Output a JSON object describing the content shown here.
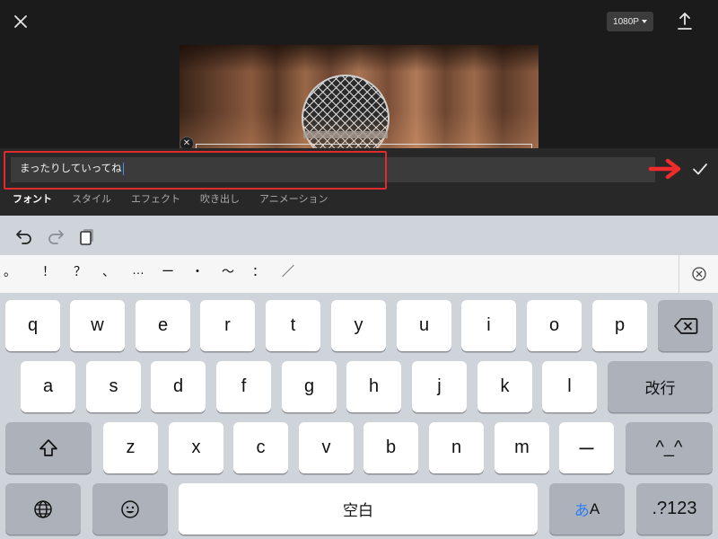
{
  "editor": {
    "resolution_label": "1080P",
    "icons": {
      "close": "close-icon",
      "export": "export-icon",
      "confirm": "checkmark-icon",
      "arrow": "red-arrow-icon"
    },
    "text_value": "まったりしていってね",
    "tabs": [
      {
        "label": "フォント",
        "active": true
      },
      {
        "label": "スタイル",
        "active": false
      },
      {
        "label": "エフェクト",
        "active": false
      },
      {
        "label": "吹き出し",
        "active": false
      },
      {
        "label": "アニメーション",
        "active": false
      }
    ],
    "colors": {
      "highlight": "#e12a2a",
      "caret": "#4a8ff6",
      "background": "#1b1b1b"
    }
  },
  "keyboard": {
    "toolbar_icons": [
      "undo-icon",
      "redo-icon",
      "clipboard-icon"
    ],
    "candidates": [
      "。",
      "！",
      "？",
      "、",
      "…",
      "ー",
      "・",
      "〜",
      "：",
      "／"
    ],
    "rows": [
      [
        "q",
        "w",
        "e",
        "r",
        "t",
        "y",
        "u",
        "i",
        "o",
        "p"
      ],
      [
        "a",
        "s",
        "d",
        "f",
        "g",
        "h",
        "j",
        "k",
        "l"
      ],
      [
        "z",
        "x",
        "c",
        "v",
        "b",
        "n",
        "m",
        "ー"
      ]
    ],
    "return_label": "改行",
    "emoticon_label": "^_^",
    "space_label": "空白",
    "kana_label_a": "あ",
    "kana_label_b": "A",
    "numbers_label": ".?123",
    "colors": {
      "kana_accent": "#2f7df6",
      "key_bg": "#ffffff",
      "dark_key_bg": "#acb1ba"
    }
  }
}
